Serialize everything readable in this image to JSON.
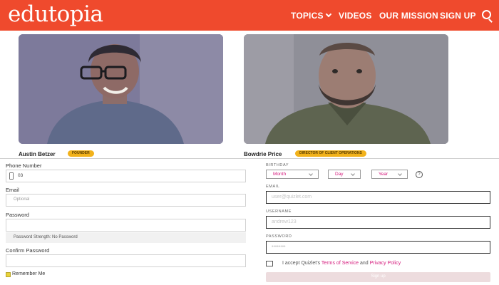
{
  "header": {
    "logo": "edutopia",
    "nav": [
      {
        "label": "TOPICS"
      },
      {
        "label": "VIDEOS"
      },
      {
        "label": "OUR MISSION"
      },
      {
        "label": "SIGN UP"
      }
    ],
    "icons": {
      "search": "search-icon",
      "topics_dropdown": "chevron-down-icon"
    }
  },
  "staff": [
    {
      "name": "Austin Betzer",
      "role": "FOUNDER"
    },
    {
      "name": "Bowdrie Price",
      "role": "DIRECTOR OF CLIENT OPERATIONS"
    }
  ],
  "left_form": {
    "phone_label": "Phone Number",
    "phone_value": "03",
    "email_label": "Email",
    "email_placeholder": "Optional",
    "password_label": "Password",
    "password_strength": "Password Strength: No Password",
    "confirm_label": "Confirm Password",
    "remember_label": "Remember Me"
  },
  "right_form": {
    "birthday_label": "BIRTHDAY",
    "month": "Month",
    "day": "Day",
    "year": "Year",
    "help": "?",
    "email_label": "EMAIL",
    "email_placeholder": "user@quizlet.com",
    "username_label": "USERNAME",
    "username_placeholder": "andrew123",
    "password_label": "PASSWORD",
    "password_placeholder": "••••••••",
    "accept_prefix": "I accept Quizlet's",
    "terms_link": "Terms of Service",
    "and": "and",
    "privacy_link": "Privacy Policy",
    "signup_button": "Sign up"
  },
  "colors": {
    "brand": "#ef4a2d",
    "badge": "#f2b21b",
    "link": "#d51b7d"
  }
}
